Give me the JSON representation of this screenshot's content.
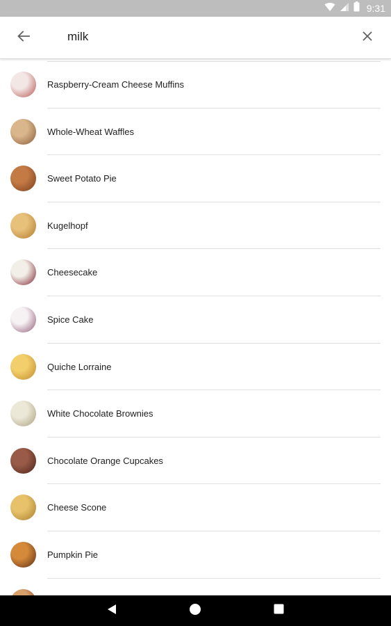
{
  "status_bar": {
    "time": "9:31",
    "icons": [
      "wifi-icon",
      "signal-icon",
      "battery-icon"
    ]
  },
  "search": {
    "query": "milk",
    "back_icon": "arrow-back-icon",
    "clear_icon": "close-icon"
  },
  "results": [
    {
      "label": "Raspberry-Cream Cheese Muffins",
      "thumb_colors": [
        "#f3e7e6",
        "#b5544e"
      ]
    },
    {
      "label": "Whole-Wheat Waffles",
      "thumb_colors": [
        "#d9b68c",
        "#8a5a37"
      ]
    },
    {
      "label": "Sweet Potato Pie",
      "thumb_colors": [
        "#c47a44",
        "#7a3e1e"
      ]
    },
    {
      "label": "Kugelhopf",
      "thumb_colors": [
        "#e7c07a",
        "#b07a2c"
      ]
    },
    {
      "label": "Cheesecake",
      "thumb_colors": [
        "#f2efe8",
        "#7d1f2e"
      ]
    },
    {
      "label": "Spice Cake",
      "thumb_colors": [
        "#f6f1f3",
        "#8e5a75"
      ]
    },
    {
      "label": "Quiche Lorraine",
      "thumb_colors": [
        "#f2cf6b",
        "#c08a2a"
      ]
    },
    {
      "label": "White Chocolate Brownies",
      "thumb_colors": [
        "#ece8d8",
        "#a89f7d"
      ]
    },
    {
      "label": "Chocolate Orange Cupcakes",
      "thumb_colors": [
        "#9a5a48",
        "#4a2418"
      ]
    },
    {
      "label": "Cheese Scone",
      "thumb_colors": [
        "#e8c26a",
        "#a77d2e"
      ]
    },
    {
      "label": "Pumpkin Pie",
      "thumb_colors": [
        "#d58a3a",
        "#5b2b14"
      ]
    },
    {
      "label": "",
      "thumb_colors": [
        "#d8a06a",
        "#7c4426"
      ]
    }
  ],
  "nav_bar": {
    "icons": [
      "back-triangle-icon",
      "home-circle-icon",
      "recents-square-icon"
    ]
  },
  "colors": {
    "status_bar": "#bdbdbd",
    "divider": "#e0e0e0",
    "text": "#212121",
    "nav_bar": "#000000"
  }
}
